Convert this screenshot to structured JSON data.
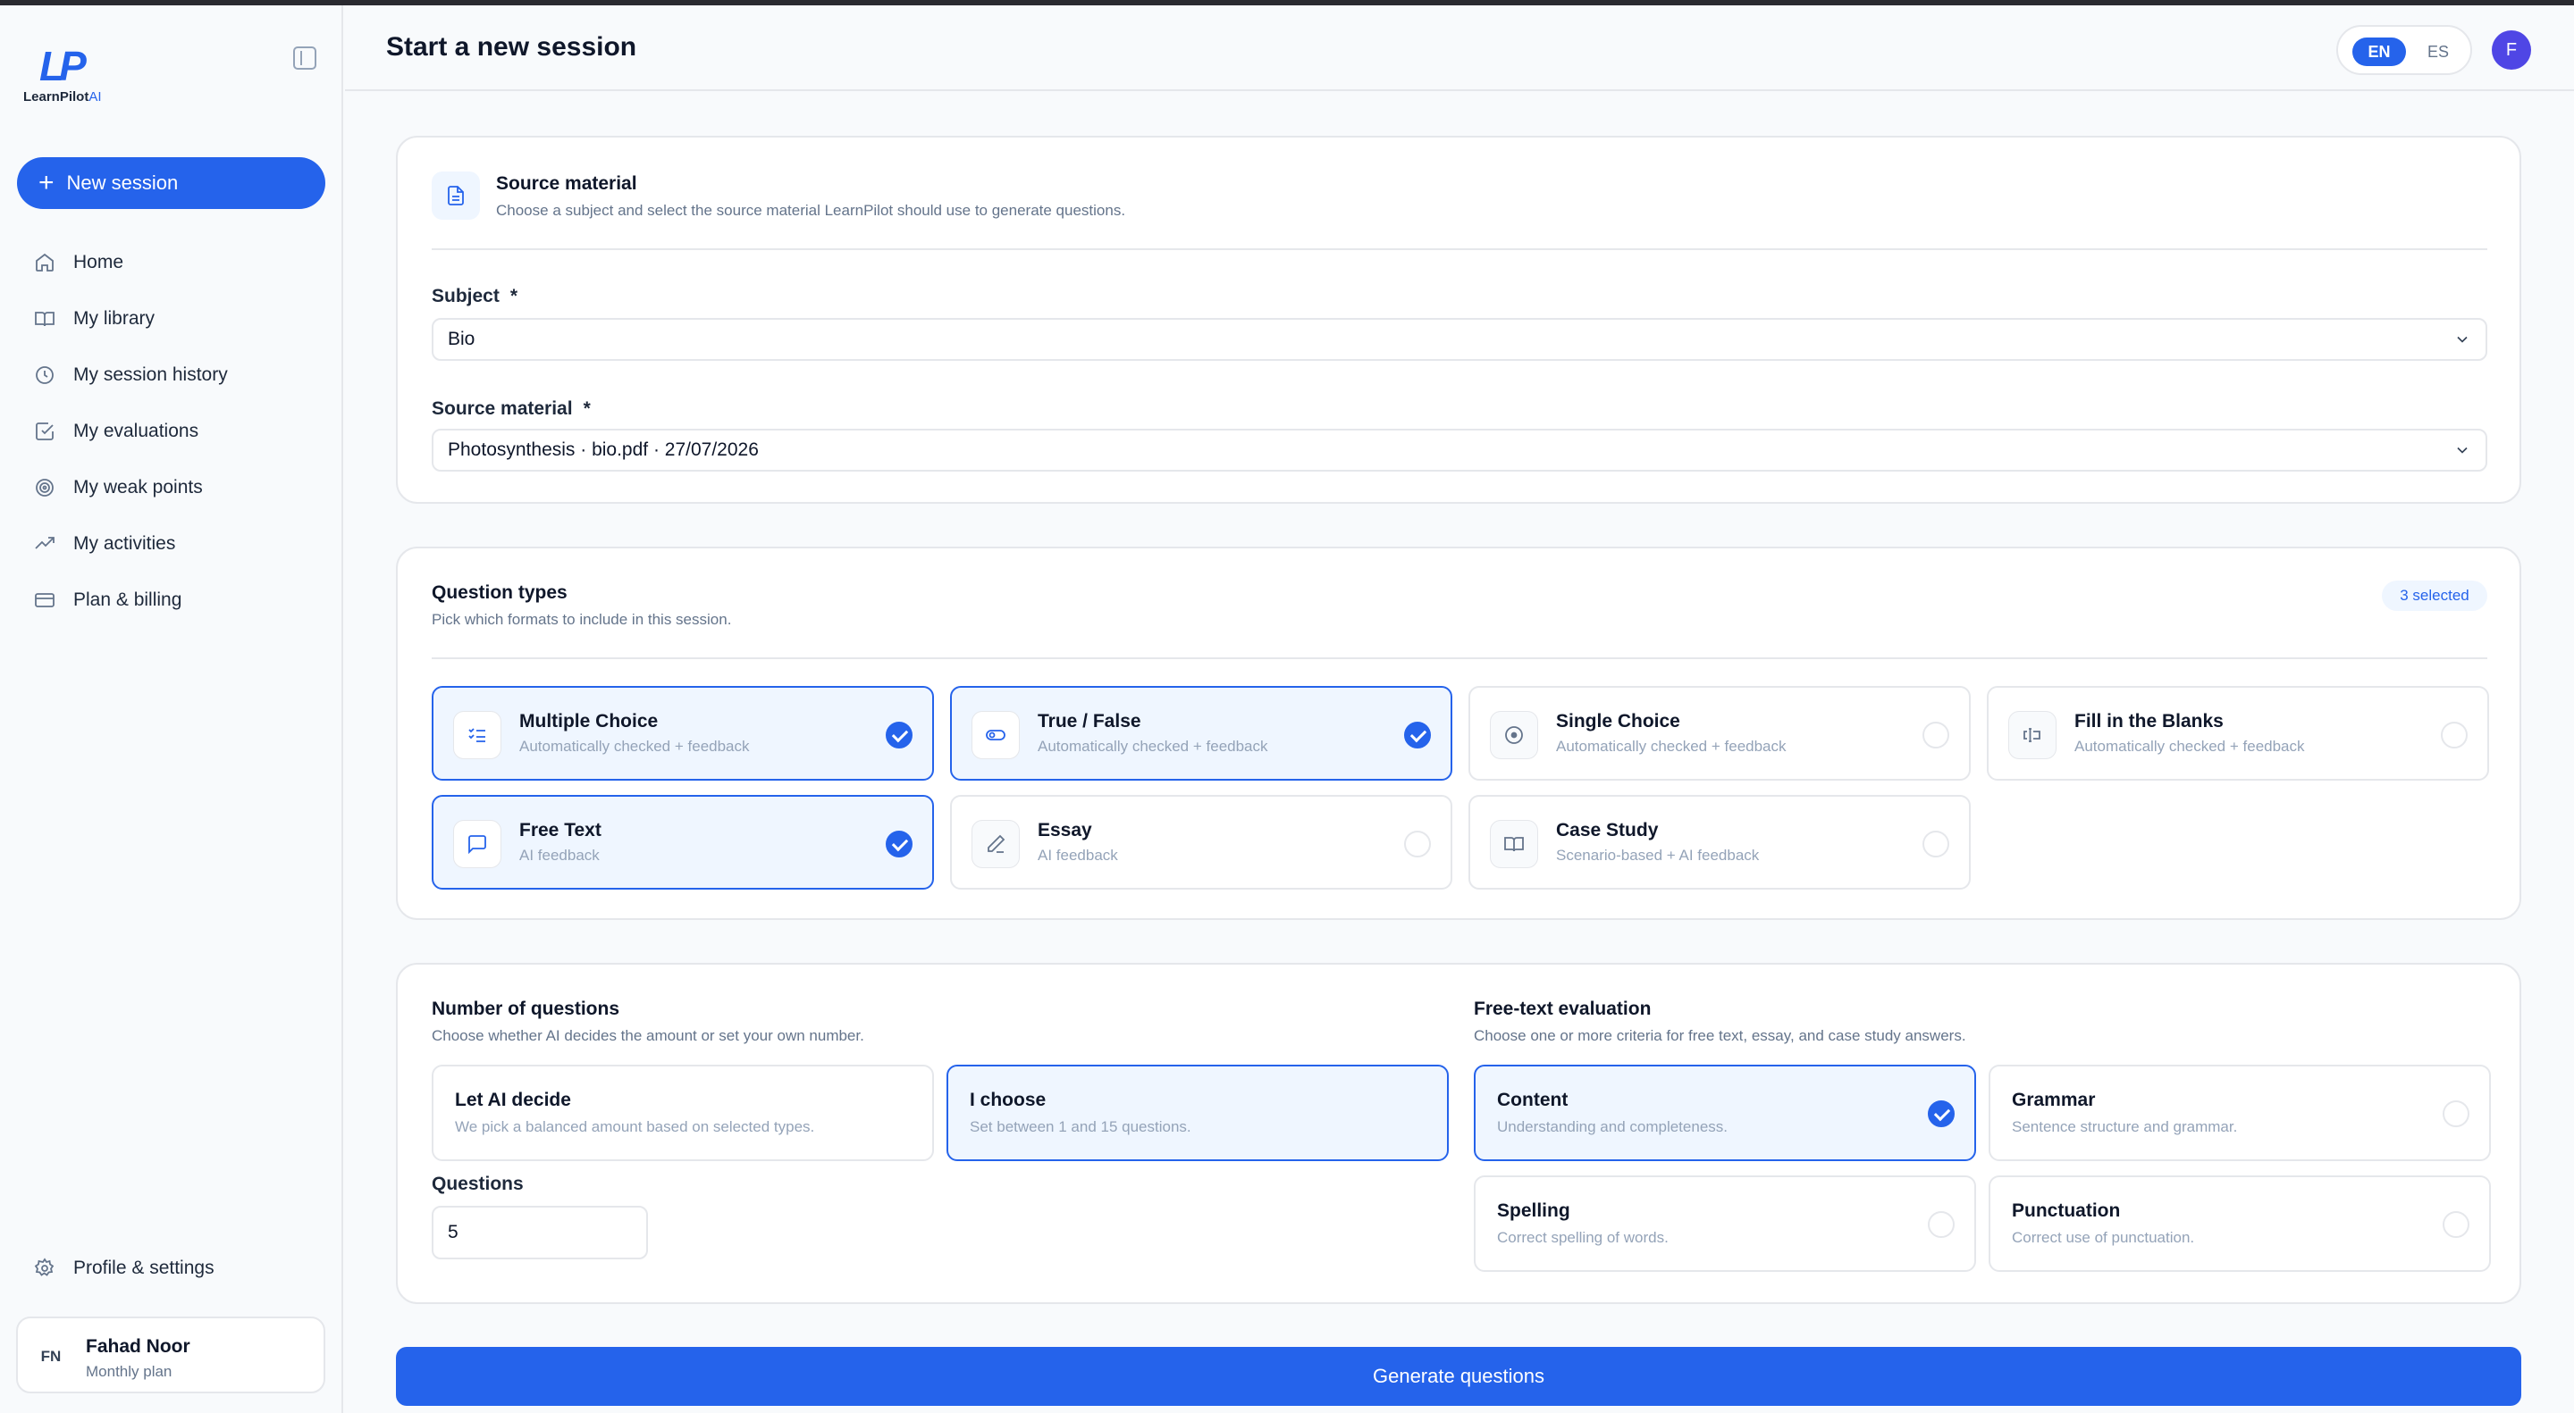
{
  "app": {
    "logo_mark": "LP",
    "logo_name": "LearnPilot",
    "logo_suffix": "AI"
  },
  "sidebar": {
    "new_session_label": "New session",
    "items": [
      {
        "label": "Home",
        "icon": "home-icon"
      },
      {
        "label": "My library",
        "icon": "book-icon"
      },
      {
        "label": "My session history",
        "icon": "clock-icon"
      },
      {
        "label": "My evaluations",
        "icon": "check-square-icon"
      },
      {
        "label": "My weak points",
        "icon": "target-icon"
      },
      {
        "label": "My activities",
        "icon": "trending-up-icon"
      },
      {
        "label": "Plan & billing",
        "icon": "credit-card-icon"
      }
    ],
    "profile_settings_label": "Profile & settings",
    "user": {
      "initials": "FN",
      "name": "Fahad Noor",
      "plan": "Monthly plan"
    }
  },
  "header": {
    "title": "Start a new session",
    "lang_en": "EN",
    "lang_es": "ES",
    "lang_selected": "EN",
    "avatar_initial": "F"
  },
  "source": {
    "title": "Source material",
    "subtitle": "Choose a subject and select the source material LearnPilot should use to generate questions.",
    "subject_label": "Subject",
    "subject_value": "Bio",
    "material_label": "Source material",
    "material_value": "Photosynthesis · bio.pdf · 27/07/2026",
    "required_mark": "*"
  },
  "types": {
    "title": "Question types",
    "subtitle": "Pick which formats to include in this session.",
    "badge": "3 selected",
    "options": [
      {
        "title": "Multiple Choice",
        "sub": "Automatically checked + feedback",
        "selected": true
      },
      {
        "title": "True / False",
        "sub": "Automatically checked + feedback",
        "selected": true
      },
      {
        "title": "Single Choice",
        "sub": "Automatically checked + feedback",
        "selected": false
      },
      {
        "title": "Fill in the Blanks",
        "sub": "Automatically checked + feedback",
        "selected": false
      },
      {
        "title": "Free Text",
        "sub": "AI feedback",
        "selected": true
      },
      {
        "title": "Essay",
        "sub": "AI feedback",
        "selected": false
      },
      {
        "title": "Case Study",
        "sub": "Scenario-based + AI feedback",
        "selected": false
      }
    ]
  },
  "count": {
    "title": "Number of questions",
    "subtitle": "Choose whether AI decides the amount or set your own number.",
    "options": [
      {
        "title": "Let AI decide",
        "sub": "We pick a balanced amount based on selected types.",
        "selected": false
      },
      {
        "title": "I choose",
        "sub": "Set between 1 and 15 questions.",
        "selected": true
      }
    ],
    "questions_label": "Questions",
    "questions_value": "5"
  },
  "evaluation": {
    "title": "Free-text evaluation",
    "subtitle": "Choose one or more criteria for free text, essay, and case study answers.",
    "options": [
      {
        "title": "Content",
        "sub": "Understanding and completeness.",
        "selected": true
      },
      {
        "title": "Grammar",
        "sub": "Sentence structure and grammar.",
        "selected": false
      },
      {
        "title": "Spelling",
        "sub": "Correct spelling of words.",
        "selected": false
      },
      {
        "title": "Punctuation",
        "sub": "Correct use of punctuation.",
        "selected": false
      }
    ]
  },
  "generate_label": "Generate questions",
  "colors": {
    "accent": "#2563eb",
    "accent_light": "#eff6ff",
    "border": "#e5e7eb",
    "muted": "#64748b"
  }
}
